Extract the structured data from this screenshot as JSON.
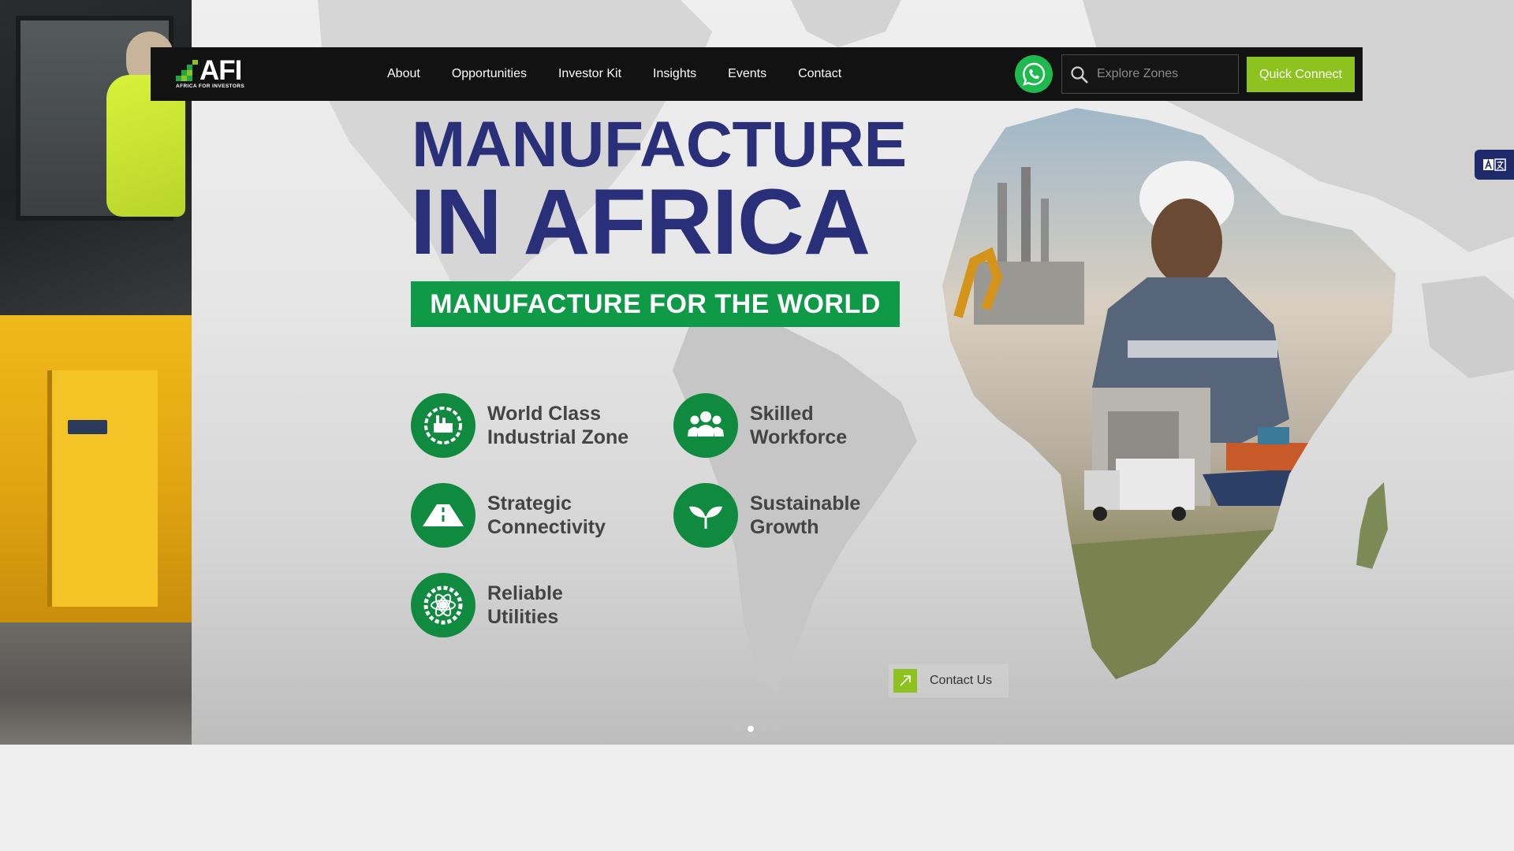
{
  "brand": {
    "logo_text": "AFI",
    "logo_sub": "AFRICA FOR INVESTORS"
  },
  "nav": {
    "links": [
      "About",
      "Opportunities",
      "Investor Kit",
      "Insights",
      "Events",
      "Contact"
    ]
  },
  "search": {
    "placeholder": "Explore Zones",
    "value": ""
  },
  "actions": {
    "quick_connect": "Quick Connect",
    "contact_us": "Contact Us"
  },
  "hero": {
    "headline_line1": "MANUFACTURE",
    "headline_line2": "IN AFRICA",
    "banner": "MANUFACTURE FOR THE WORLD",
    "features": [
      {
        "line1": "World Class",
        "line2": "Industrial Zone",
        "icon": "industrial-zone-icon"
      },
      {
        "line1": "Skilled",
        "line2": "Workforce",
        "icon": "workforce-icon"
      },
      {
        "line1": "Strategic",
        "line2": "Connectivity",
        "icon": "road-icon"
      },
      {
        "line1": "Sustainable",
        "line2": "Growth",
        "icon": "leaf-icon"
      },
      {
        "line1": "Reliable",
        "line2": "Utilities",
        "icon": "utilities-gear-icon"
      }
    ]
  },
  "carousel": {
    "slide_count": 4,
    "active_index": 1
  },
  "colors": {
    "navy": "#2a2f7a",
    "green": "#0f9a48",
    "lime": "#8dc21f",
    "whatsapp": "#1fba4f",
    "nav_bg": "#121212"
  }
}
